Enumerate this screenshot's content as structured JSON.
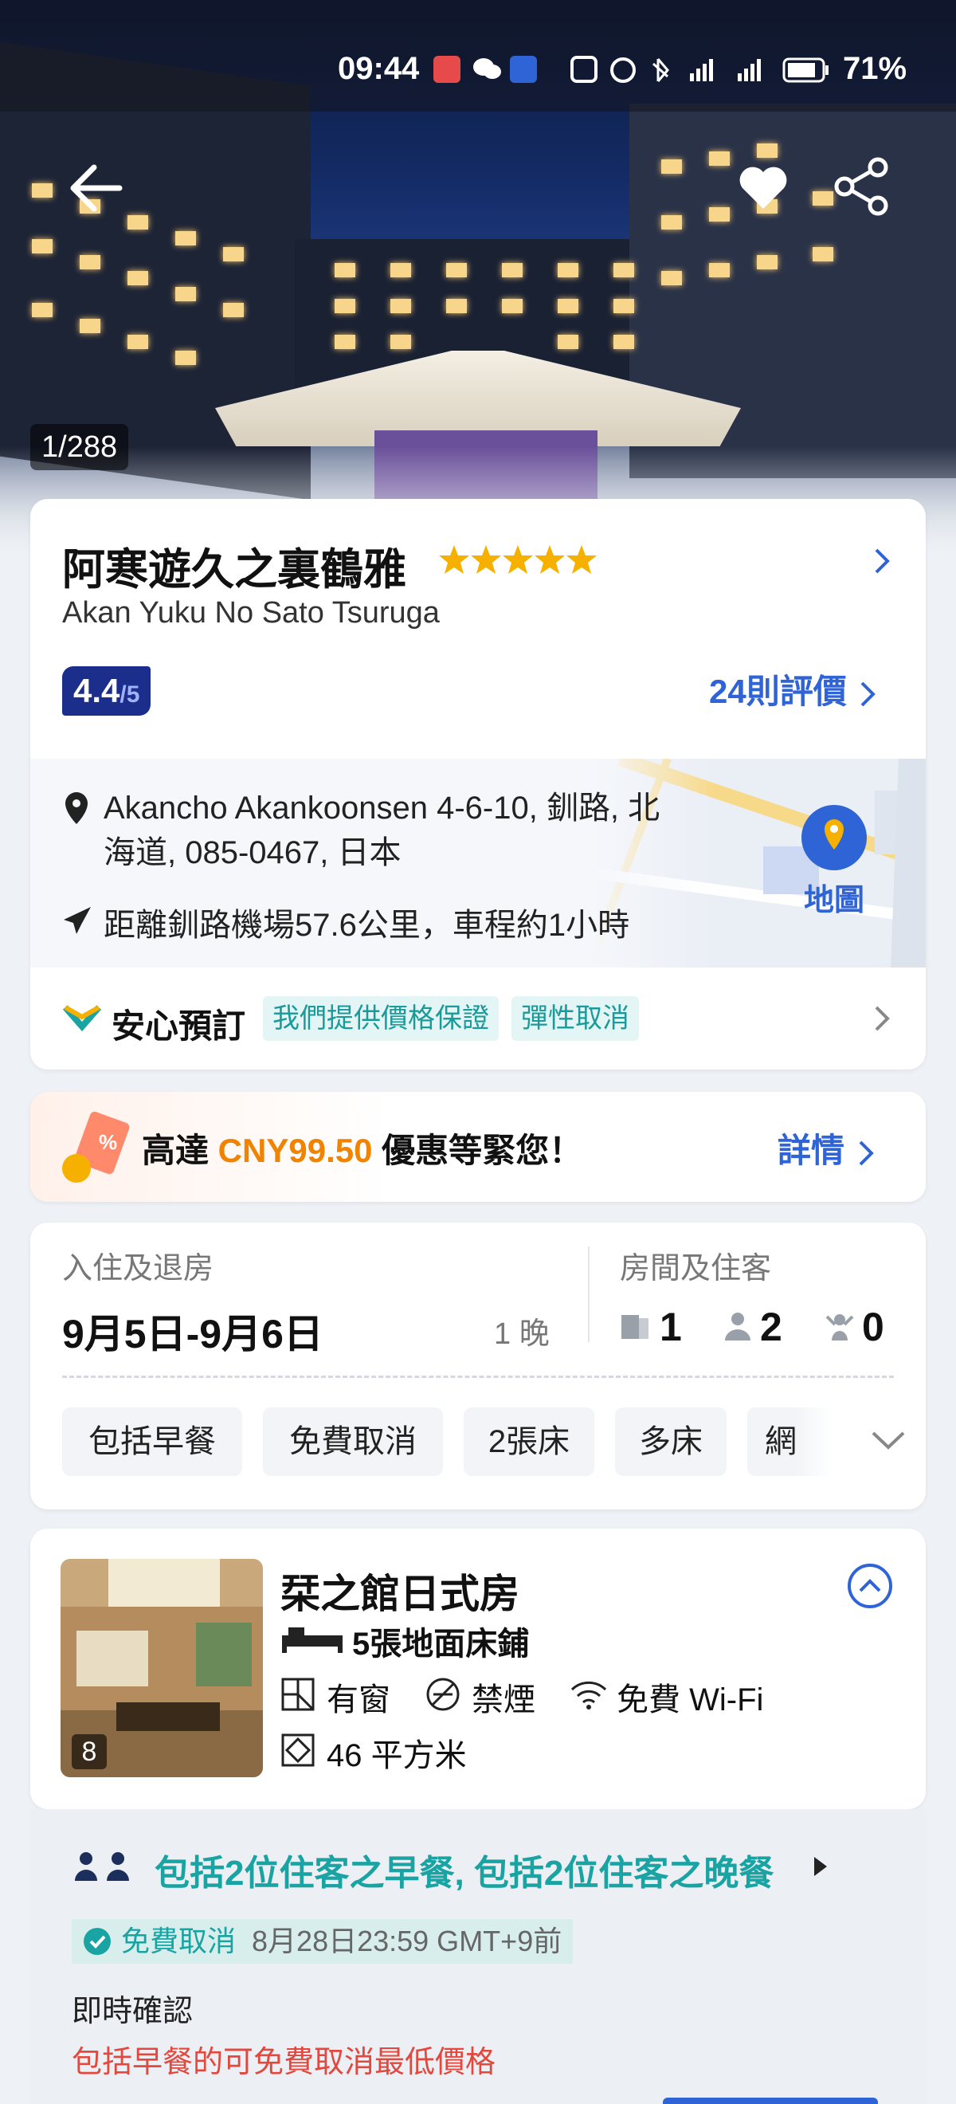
{
  "status_bar": {
    "time": "09:44",
    "battery": "71%"
  },
  "gallery": {
    "counter": "1/288"
  },
  "hotel": {
    "name": "阿寒遊久之裏鶴雅",
    "name_en": "Akan Yuku No Sato Tsuruga",
    "stars": 5,
    "rating_value": "4.4",
    "rating_scale": "/5",
    "reviews_label": "24則評價",
    "address_line1": "Akancho Akankoonsen 4-6-10, 釧路, 北",
    "address_line2": "海道, 085-0467, 日本",
    "distance": "距離釧路機場57.6公里，車程約1小時",
    "map_label": "地圖",
    "assurance_title": "安心預訂",
    "assurance_tags": [
      "我們提供價格保證",
      "彈性取消"
    ]
  },
  "promo": {
    "prefix": "高達 ",
    "amount": "CNY99.50",
    "suffix": " 優惠等緊您！",
    "link": "詳情"
  },
  "booking": {
    "dates_label": "入住及退房",
    "dates": "9月5日-9月6日",
    "nights": "1 晚",
    "guests_label": "房間及住客",
    "rooms": "1",
    "adults": "2",
    "children": "0"
  },
  "filters": [
    "包括早餐",
    "免費取消",
    "2張床",
    "多床",
    "網"
  ],
  "room": {
    "name": "栞之館日式房",
    "beds": "5張地面床鋪",
    "window": "有窗",
    "smoking": "禁煙",
    "wifi": "免費 Wi-Fi",
    "size": "46 平方米",
    "photo_count": "8"
  },
  "offer": {
    "meals": "包括2位住客之早餐, 包括2位住客之晚餐",
    "cancel_label": "免費取消",
    "cancel_deadline": "8月28日23:59 GMT+9前",
    "confirm": "即時確認",
    "note": "包括早餐的可免費取消最低價格"
  },
  "colors": {
    "accent": "#2f64d6",
    "teal": "#1aa3a3",
    "orange": "#f08300",
    "red": "#e2483d",
    "navy": "#1b2e8c",
    "star": "#f6b100"
  }
}
